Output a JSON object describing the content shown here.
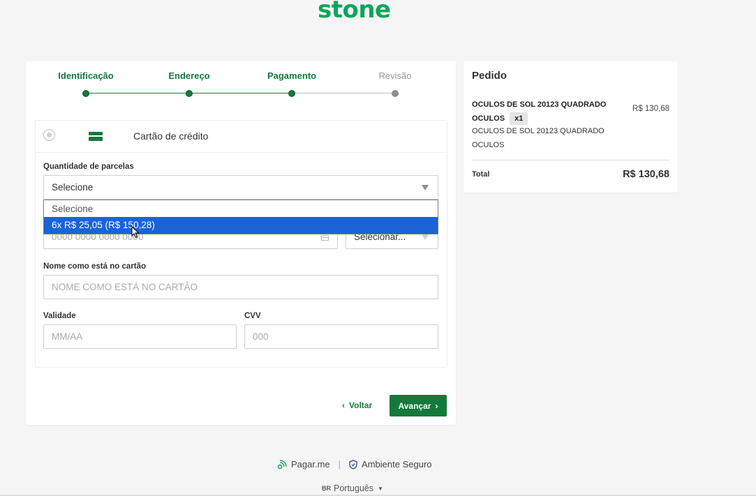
{
  "brand": {
    "logo_text": "stone",
    "accent_color": "#127a3b"
  },
  "stepper": {
    "steps": [
      {
        "label": "Identificação",
        "state": "done"
      },
      {
        "label": "Endereço",
        "state": "done"
      },
      {
        "label": "Pagamento",
        "state": "current"
      },
      {
        "label": "Revisão",
        "state": "pending"
      }
    ]
  },
  "payment": {
    "method_label": "Cartão de crédito",
    "installments": {
      "label": "Quantidade de parcelas",
      "selected": "Selecione",
      "options": [
        "Selecione",
        "6x R$ 25,05 (R$ 150,28)"
      ],
      "highlighted_option": "6x R$ 25,05 (R$ 150,28)"
    },
    "card_number": {
      "placeholder": "0000 0000 0000 0000"
    },
    "card_brand": {
      "selected": "Selecionar..."
    },
    "holder_name": {
      "label": "Nome como está no cartão",
      "placeholder": "NOME COMO ESTÁ NO CARTÃO"
    },
    "expiry": {
      "label": "Validade",
      "placeholder": "MM/AA"
    },
    "cvv": {
      "label": "CVV",
      "placeholder": "000"
    }
  },
  "actions": {
    "back_label": "Voltar",
    "next_label": "Avançar"
  },
  "order": {
    "title": "Pedido",
    "item": {
      "name": "OCULOS DE SOL 20123 QUADRADO OCULOS",
      "quantity": "x1",
      "price": "R$ 130,68",
      "description": "OCULOS DE SOL 20123 QUADRADO OCULOS"
    },
    "total_label": "Total",
    "total_value": "R$ 130,68"
  },
  "footer": {
    "provider": "Pagar.me",
    "secure": "Ambiente Seguro",
    "lang_code": "BR",
    "language": "Português"
  }
}
